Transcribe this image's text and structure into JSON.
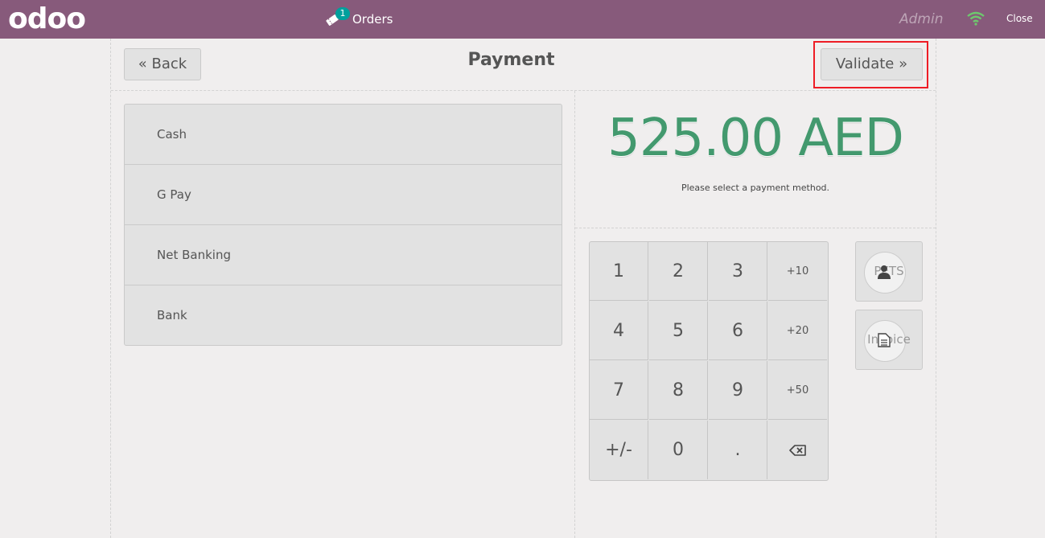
{
  "header": {
    "logo_text": "odoo",
    "orders_badge": "1",
    "orders_label": "Orders",
    "user": "Admin",
    "close_label": "Close"
  },
  "payment_screen": {
    "title": "Payment",
    "back_label": "Back",
    "validate_label": "Validate",
    "methods": [
      "Cash",
      "G Pay",
      "Net Banking",
      "Bank"
    ],
    "total": "525.00 AED",
    "hint": "Please select a payment method.",
    "numpad": {
      "k1": "1",
      "k2": "2",
      "k3": "3",
      "k10": "+10",
      "k4": "4",
      "k5": "5",
      "k6": "6",
      "k20": "+20",
      "k7": "7",
      "k8": "8",
      "k9": "9",
      "k50": "+50",
      "kpm": "+/-",
      "k0": "0",
      "kdot": "."
    },
    "customer_label": "PETS",
    "invoice_label": "Invoice"
  },
  "colors": {
    "brand": "#875a7b",
    "total": "#43996e",
    "highlight": "#ee1c25"
  }
}
